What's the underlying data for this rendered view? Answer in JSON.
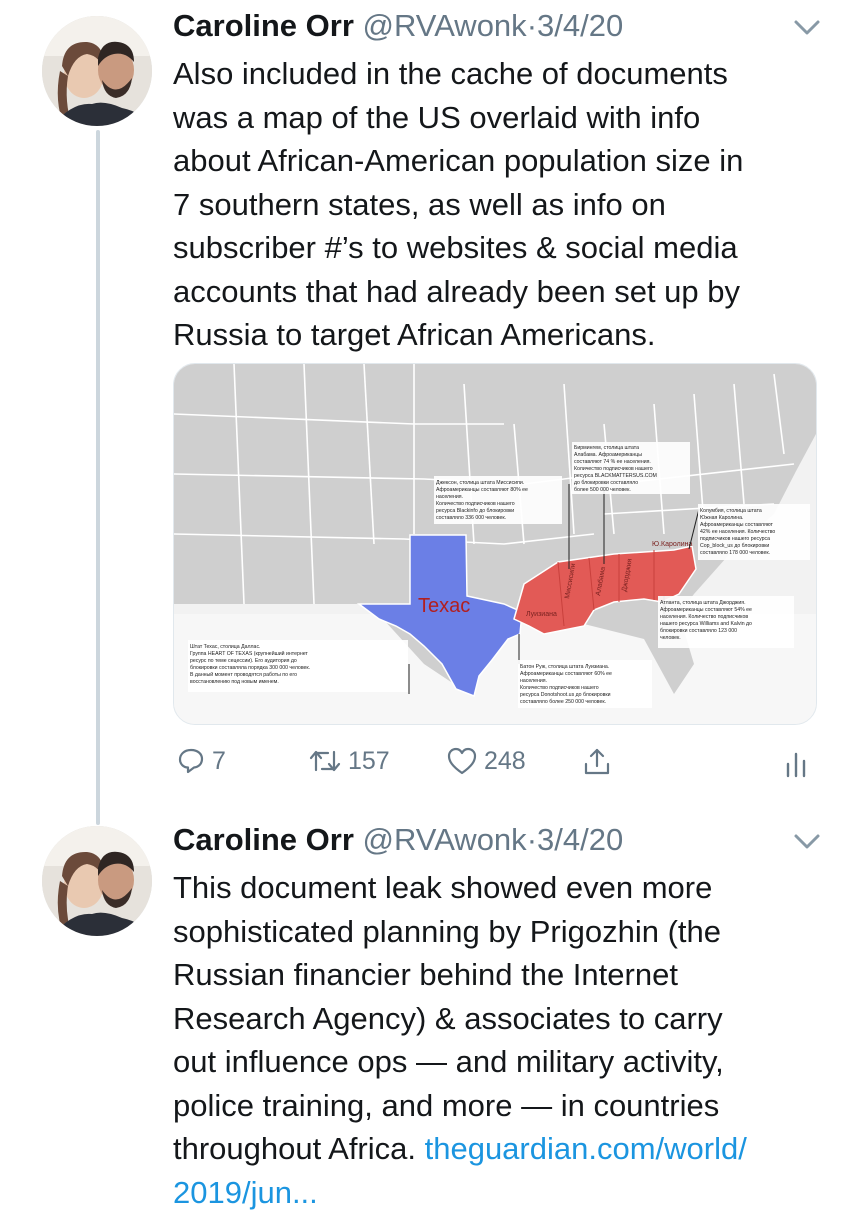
{
  "tweets": [
    {
      "author_name": "Caroline Orr",
      "handle": "@RVAwonk",
      "separator": "·",
      "date": "3/4/20",
      "lines": [
        "Also included in the cache of documents",
        "was a map of the US overlaid with info",
        "about African-American population size in",
        "7 southern states, as well as info on",
        "subscriber #’s to websites & social media",
        "accounts that had already been set up by",
        "Russia to target African Americans."
      ],
      "media": {
        "map_label": "Texac",
        "notes": {
          "alabama": [
            "Бирмингем, столица штата",
            "Алабама. Афроамериканцы",
            "составляют 74 % ее населения.",
            "Количество подписчиков нашего",
            "ресурса BLACKMATTERSUS.COM",
            "до блокировки составляло",
            "более 500 000 человек."
          ],
          "mississippi": [
            "Джексон, столица штата Миссисипи.",
            "Афроамериканцы составляют 80% ее",
            "населения.",
            "Количество подписчиков нашего",
            "ресурса Blackinfo до блокировки",
            "составляло 336 000 человек."
          ],
          "south_carolina": [
            "Колумбия, столица штата",
            "Южная Каролина.",
            "Афроамериканцы составляют",
            "42% ее населения. Количество",
            "подписчиков нашего ресурса",
            "Cop_block_us до блокировки",
            "составляло 178 000 человек."
          ],
          "georgia": [
            "Атланта, столица штата Джорджия.",
            "Афроамериканцы составляют 54% ее",
            "населения. Количество подписчиков",
            "нашего ресурса Williams and Kalvin до",
            "блокировки составляло 123 000",
            "человек."
          ],
          "louisiana": [
            "Батон Руж, столица штата Луизиана.",
            "Афроамериканцы составляют 60% ее",
            "населения.",
            "Количество подписчиков нашего",
            "ресурса Donotshoot.us до блокировки",
            "составляло более 250 000 человек."
          ],
          "texas": [
            "Штат Техас, столица Даллас.",
            "Группа HEART OF TEXAS (крупнейший интернет",
            "ресурс по теме сецессии). Его аудитория до",
            "блокировки составляла порядка 300 000 человек.",
            "В данный момент проводятся работы по его",
            "восстановлению под новым именем."
          ]
        },
        "state_labels": [
          "Луизиана",
          "Миссисипи",
          "Алабама",
          "Джорджия",
          "Ю.Каролина"
        ]
      },
      "stats": {
        "replies": "7",
        "retweets": "157",
        "likes": "248"
      },
      "icons": [
        "reply-icon",
        "retweet-icon",
        "like-icon",
        "share-icon",
        "analytics-icon",
        "chevron-down-icon"
      ]
    },
    {
      "author_name": "Caroline Orr",
      "handle": "@RVAwonk",
      "separator": "·",
      "date": "3/4/20",
      "lines": [
        "This document leak showed even more",
        "sophisticated planning by Prigozhin (the",
        "Russian financier behind the Internet",
        "Research Agency) & associates to carry",
        "out influence ops — and military activity,",
        "police training, and more — in countries"
      ],
      "line7_text": "throughout Africa. ",
      "link_part1": "theguardian.com/world/",
      "link_part2": "2019/jun..."
    }
  ],
  "colors": {
    "link": "#1b95e0",
    "muted": "#657786",
    "texas": "#6b7fe6",
    "southern_states": "#e25a56",
    "map_states": "#cfcfcf"
  }
}
